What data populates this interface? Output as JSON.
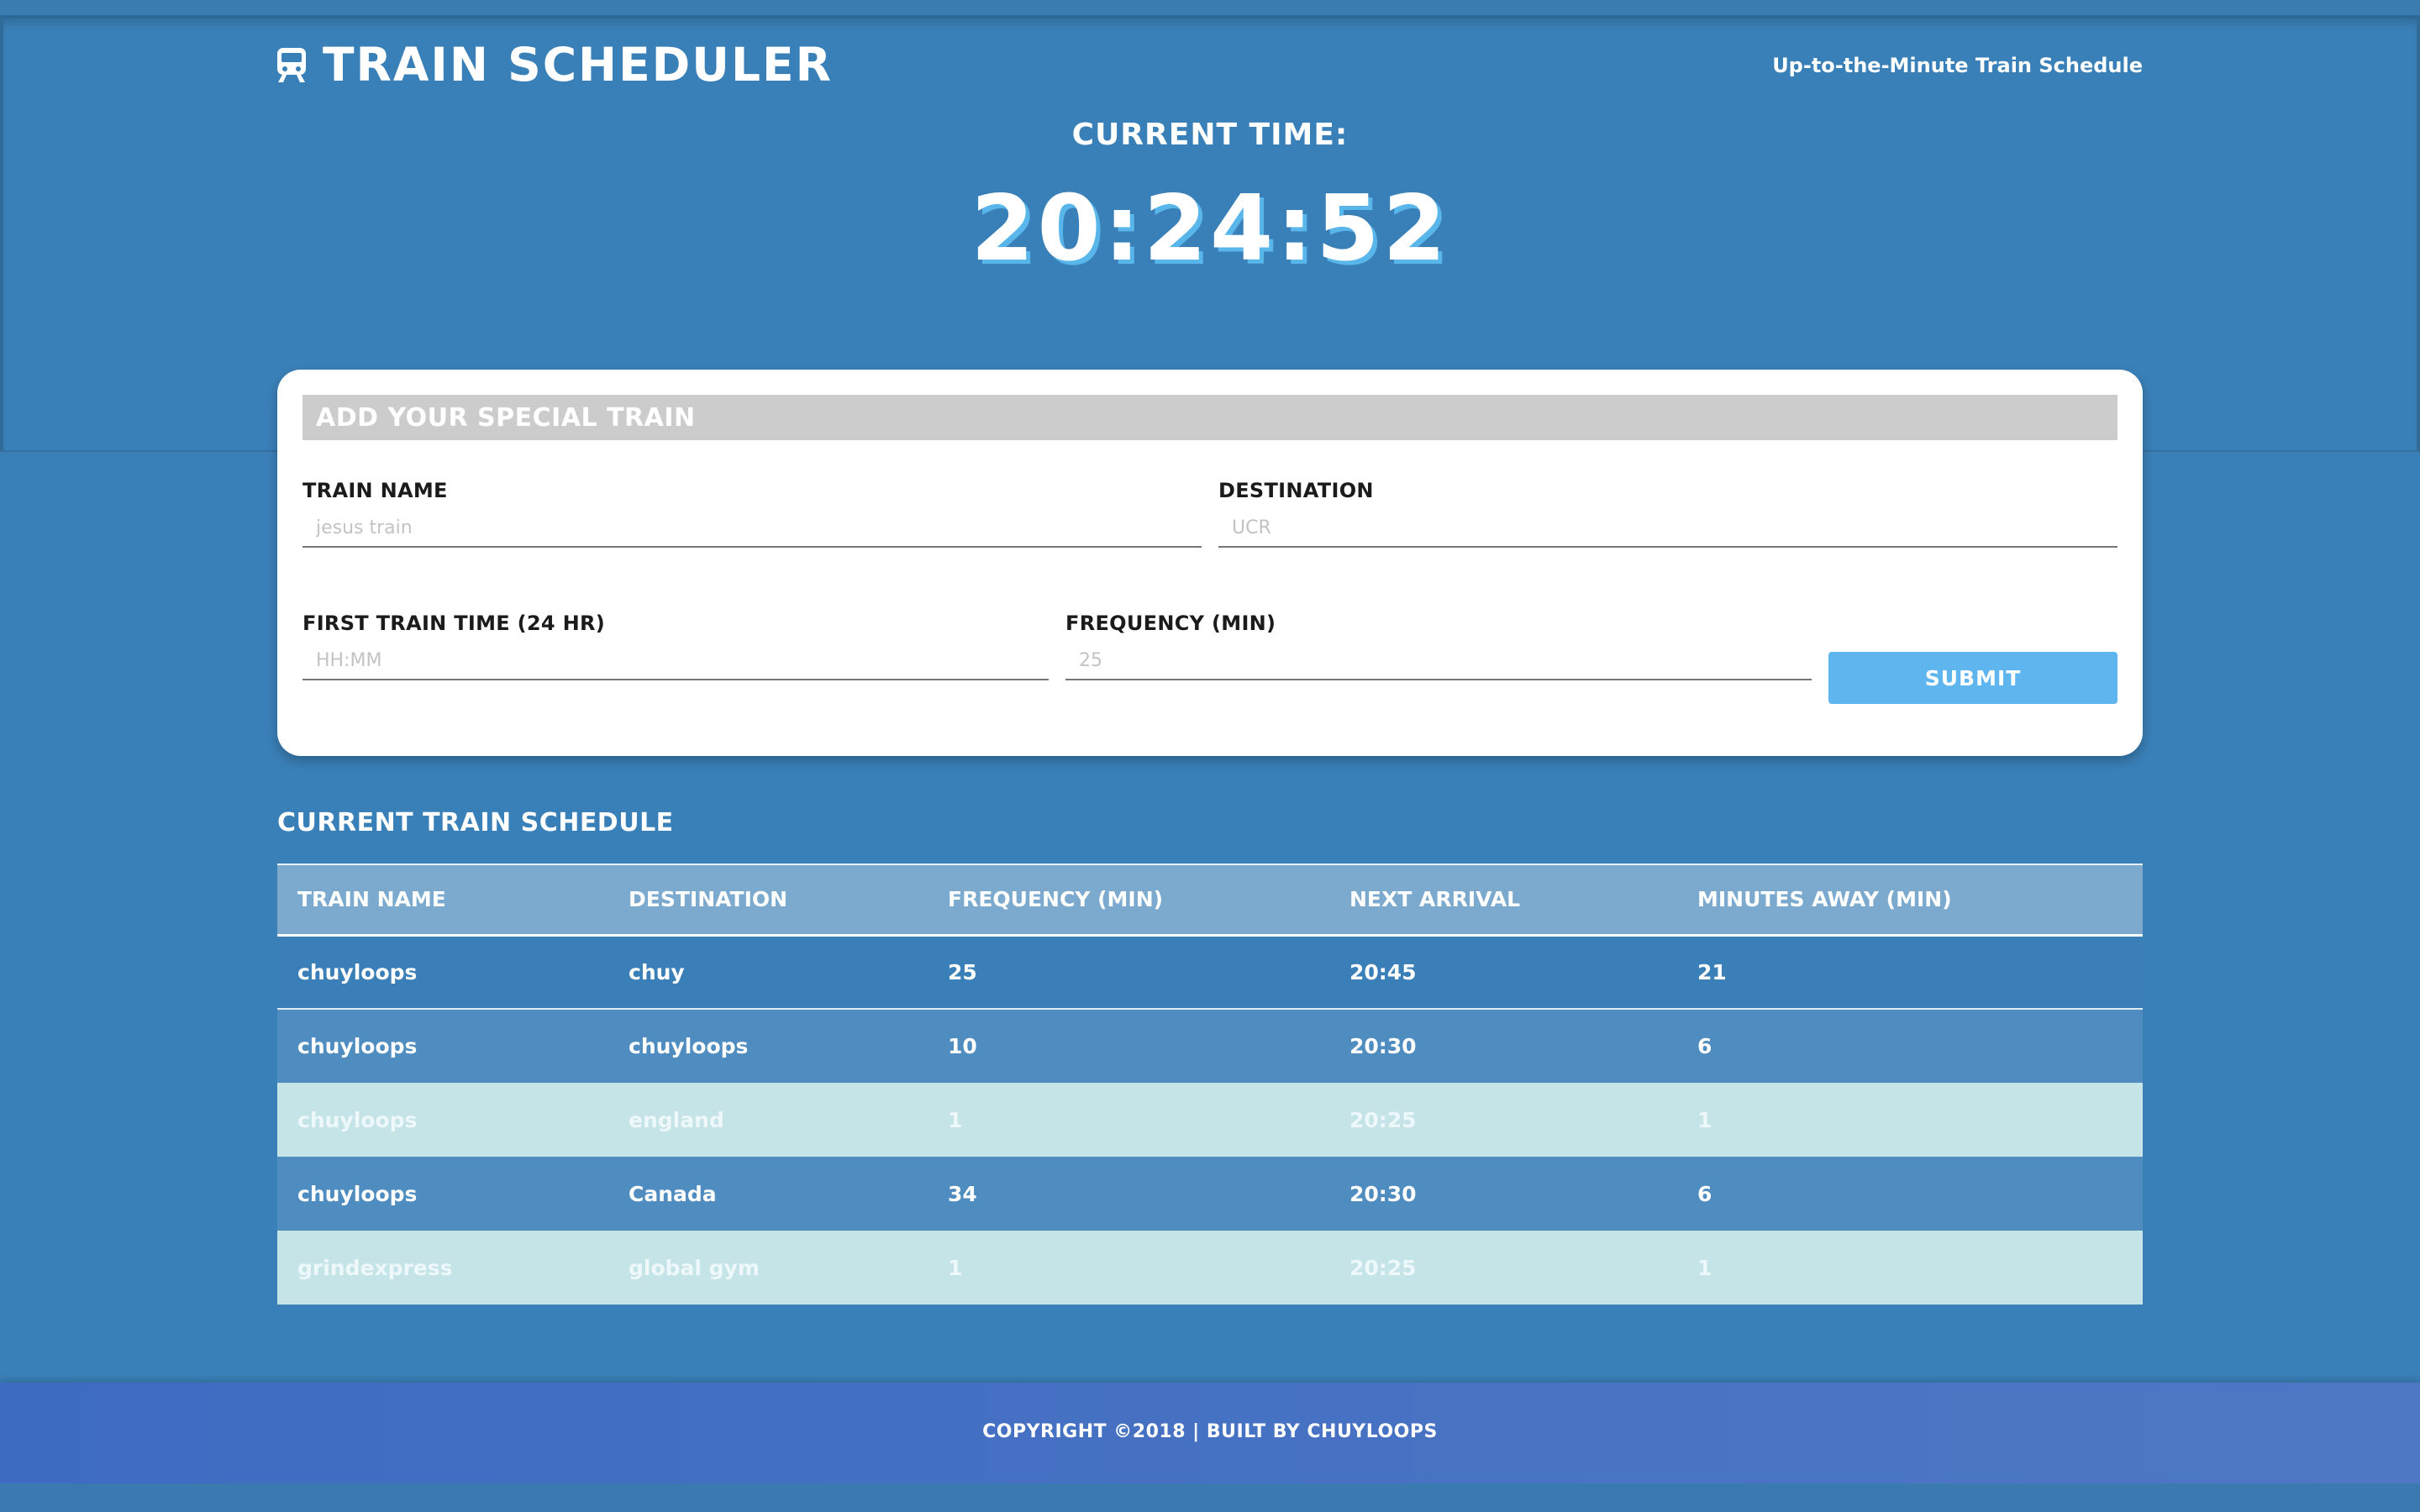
{
  "header": {
    "brand_icon": "train-icon",
    "title": "TRAIN SCHEDULER",
    "tagline": "Up-to-the-Minute Train Schedule",
    "time_label": "CURRENT TIME:",
    "time_value": "20:24:52"
  },
  "form": {
    "heading": "ADD YOUR SPECIAL TRAIN",
    "train_name_label": "TRAIN NAME",
    "train_name_placeholder": "jesus train",
    "destination_label": "DESTINATION",
    "destination_placeholder": "UCR",
    "first_time_label": "FIRST TRAIN TIME (24 HR)",
    "first_time_placeholder": "HH:MM",
    "frequency_label": "FREQUENCY (MIN)",
    "frequency_placeholder": "25",
    "submit_label": "SUBMIT"
  },
  "schedule": {
    "title": "CURRENT TRAIN SCHEDULE",
    "columns": [
      "TRAIN NAME",
      "DESTINATION",
      "FREQUENCY (MIN)",
      "NEXT ARRIVAL",
      "MINUTES AWAY (MIN)"
    ],
    "rows": [
      [
        "chuyloops",
        "chuy",
        "25",
        "20:45",
        "21"
      ],
      [
        "chuyloops",
        "chuyloops",
        "10",
        "20:30",
        "6"
      ],
      [
        "chuyloops",
        "england",
        "1",
        "20:25",
        "1"
      ],
      [
        "chuyloops",
        "Canada",
        "34",
        "20:30",
        "6"
      ],
      [
        "grindexpress",
        "global gym",
        "1",
        "20:25",
        "1"
      ]
    ]
  },
  "footer": {
    "text": "COPYRIGHT ©2018 | BUILT BY CHUYLOOPS"
  },
  "colors": {
    "background": "#3a80b8",
    "accent": "#5fb6ef",
    "footer": "#4170c4",
    "row_highlight": "#c5e4e8"
  }
}
